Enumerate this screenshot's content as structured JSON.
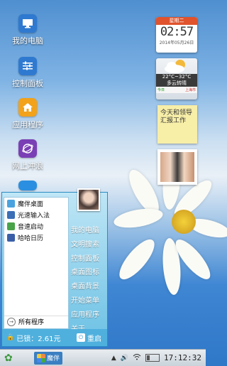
{
  "desktop": {
    "icons": [
      {
        "label": "我的电脑",
        "icon": "computer-icon"
      },
      {
        "label": "控制面板",
        "icon": "control-panel-icon"
      },
      {
        "label": "应用程序",
        "icon": "house-icon"
      },
      {
        "label": "网上冲浪",
        "icon": "browser-icon"
      }
    ]
  },
  "widgets": {
    "calendar": {
      "weekday": "星期二",
      "time": "02:57",
      "date": "2014年05月26日"
    },
    "weather": {
      "temp": "22°C~32°C",
      "desc": "多云转晴",
      "day": "今日",
      "city": "上海市"
    },
    "note": {
      "text": "今天和领导汇报工作"
    }
  },
  "start_menu": {
    "left_items": [
      {
        "label": "魔伴桌面",
        "icon": "flower-icon",
        "color": "#4aa3df"
      },
      {
        "label": "光速输入法",
        "icon": "input-method-icon",
        "color": "#3b6fb6"
      },
      {
        "label": "音速启动",
        "icon": "v-launch-icon",
        "color": "#49a349"
      },
      {
        "label": "哈哈日历",
        "icon": "calendar-icon",
        "color": "#3a5fa8"
      }
    ],
    "all_programs": "所有程序",
    "right_links": [
      "我的电脑",
      "文明搜索",
      "控制面板",
      "桌面图标",
      "桌面背景",
      "开始菜单",
      "应用程序",
      "关于"
    ],
    "lock_text": "已锁：2.61元",
    "restart_label": "重启"
  },
  "taskbar": {
    "start_icon": "flower-start-icon",
    "app_label": "魔伴",
    "clock": "17:12:32"
  },
  "colors": {
    "accent": "#2b8cc3",
    "taskbar": "#c9d2da"
  }
}
